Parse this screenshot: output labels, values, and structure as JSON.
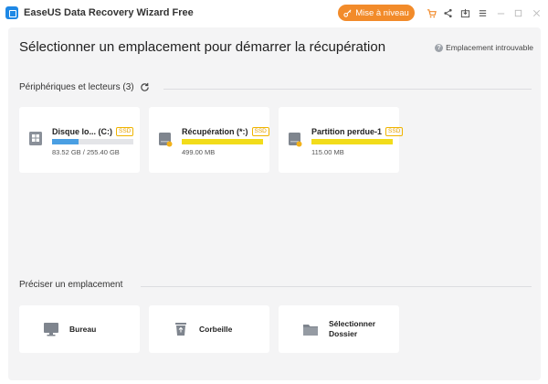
{
  "window": {
    "title": "EaseUS Data Recovery Wizard Free",
    "upgrade_label": "Mise à niveau",
    "accent": "#f28b2a"
  },
  "icons": [
    "app-logo",
    "key-icon",
    "cart-icon",
    "share-icon",
    "export-icon",
    "menu-icon",
    "minimize-icon",
    "maximize-icon",
    "close-icon",
    "help-icon",
    "refresh-icon",
    "windows-drive-icon",
    "drive-icon",
    "monitor-icon",
    "recycle-bin-icon",
    "folder-icon"
  ],
  "main": {
    "title": "Sélectionner un emplacement pour démarrer la récupération",
    "help_link": "Emplacement introuvable",
    "devices": {
      "heading": "Périphériques et lecteurs (3)",
      "drives": [
        {
          "name": "Disque lo...  (C:)",
          "badge": "SSD",
          "size": "83.52 GB / 255.40 GB",
          "usage": 0.33,
          "color": "#4a9fe3"
        },
        {
          "name": "Récupération (*:)",
          "badge": "SSD",
          "size": "499.00 MB",
          "usage": 1.0,
          "color": "#f2dc1a"
        },
        {
          "name": "Partition perdue-1",
          "badge": "SSD",
          "size": "115.00 MB",
          "usage": 1.0,
          "color": "#f2dc1a"
        }
      ]
    },
    "locations": {
      "heading": "Préciser un emplacement",
      "items": [
        {
          "label": "Bureau"
        },
        {
          "label": "Corbeille"
        },
        {
          "label": "Sélectionner\nDossier"
        }
      ]
    }
  }
}
